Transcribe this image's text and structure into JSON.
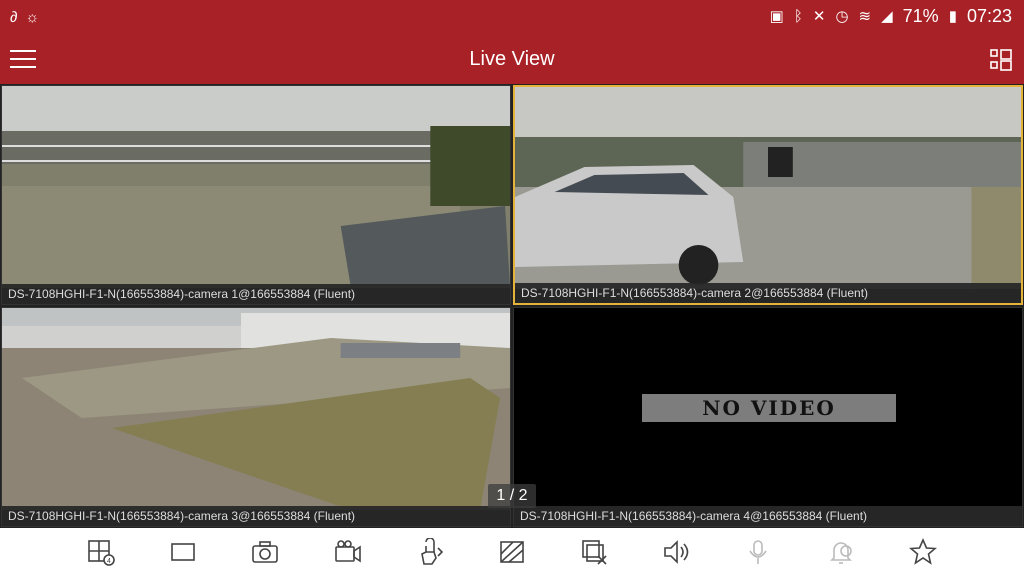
{
  "status_bar": {
    "battery_percent": "71%",
    "time": "07:23",
    "left_icons": [
      "app-notification-icon",
      "weather-icon"
    ],
    "right_icons": [
      "vibrate-icon",
      "bluetooth-icon",
      "mute-icon",
      "alarm-icon",
      "wifi-icon",
      "signal-icon",
      "battery-icon"
    ]
  },
  "app_bar": {
    "title": "Live View"
  },
  "cameras": [
    {
      "caption": "DS-7108HGHI-F1-N(166553884)-camera 1@166553884  (Fluent)",
      "selected": false,
      "no_video": false
    },
    {
      "caption": "DS-7108HGHI-F1-N(166553884)-camera 2@166553884  (Fluent)",
      "selected": true,
      "no_video": false
    },
    {
      "caption": "DS-7108HGHI-F1-N(166553884)-camera 3@166553884  (Fluent)",
      "selected": false,
      "no_video": false
    },
    {
      "caption": "DS-7108HGHI-F1-N(166553884)-camera 4@166553884  (Fluent)",
      "selected": false,
      "no_video": true,
      "no_video_label": "NO VIDEO"
    }
  ],
  "pager": {
    "label": "1 / 2"
  },
  "toolbar": {
    "items": [
      {
        "icon": "window-split-icon",
        "badge": "4",
        "enabled": true
      },
      {
        "icon": "fullscreen-icon",
        "enabled": true
      },
      {
        "icon": "camera-snapshot-icon",
        "enabled": true
      },
      {
        "icon": "video-record-icon",
        "enabled": true
      },
      {
        "icon": "ptz-control-icon",
        "enabled": true
      },
      {
        "icon": "image-quality-icon",
        "enabled": true
      },
      {
        "icon": "stop-all-icon",
        "enabled": true
      },
      {
        "icon": "audio-icon",
        "enabled": true
      },
      {
        "icon": "microphone-icon",
        "enabled": false
      },
      {
        "icon": "alarm-bell-icon",
        "enabled": false
      },
      {
        "icon": "favorite-star-icon",
        "enabled": true
      }
    ]
  }
}
